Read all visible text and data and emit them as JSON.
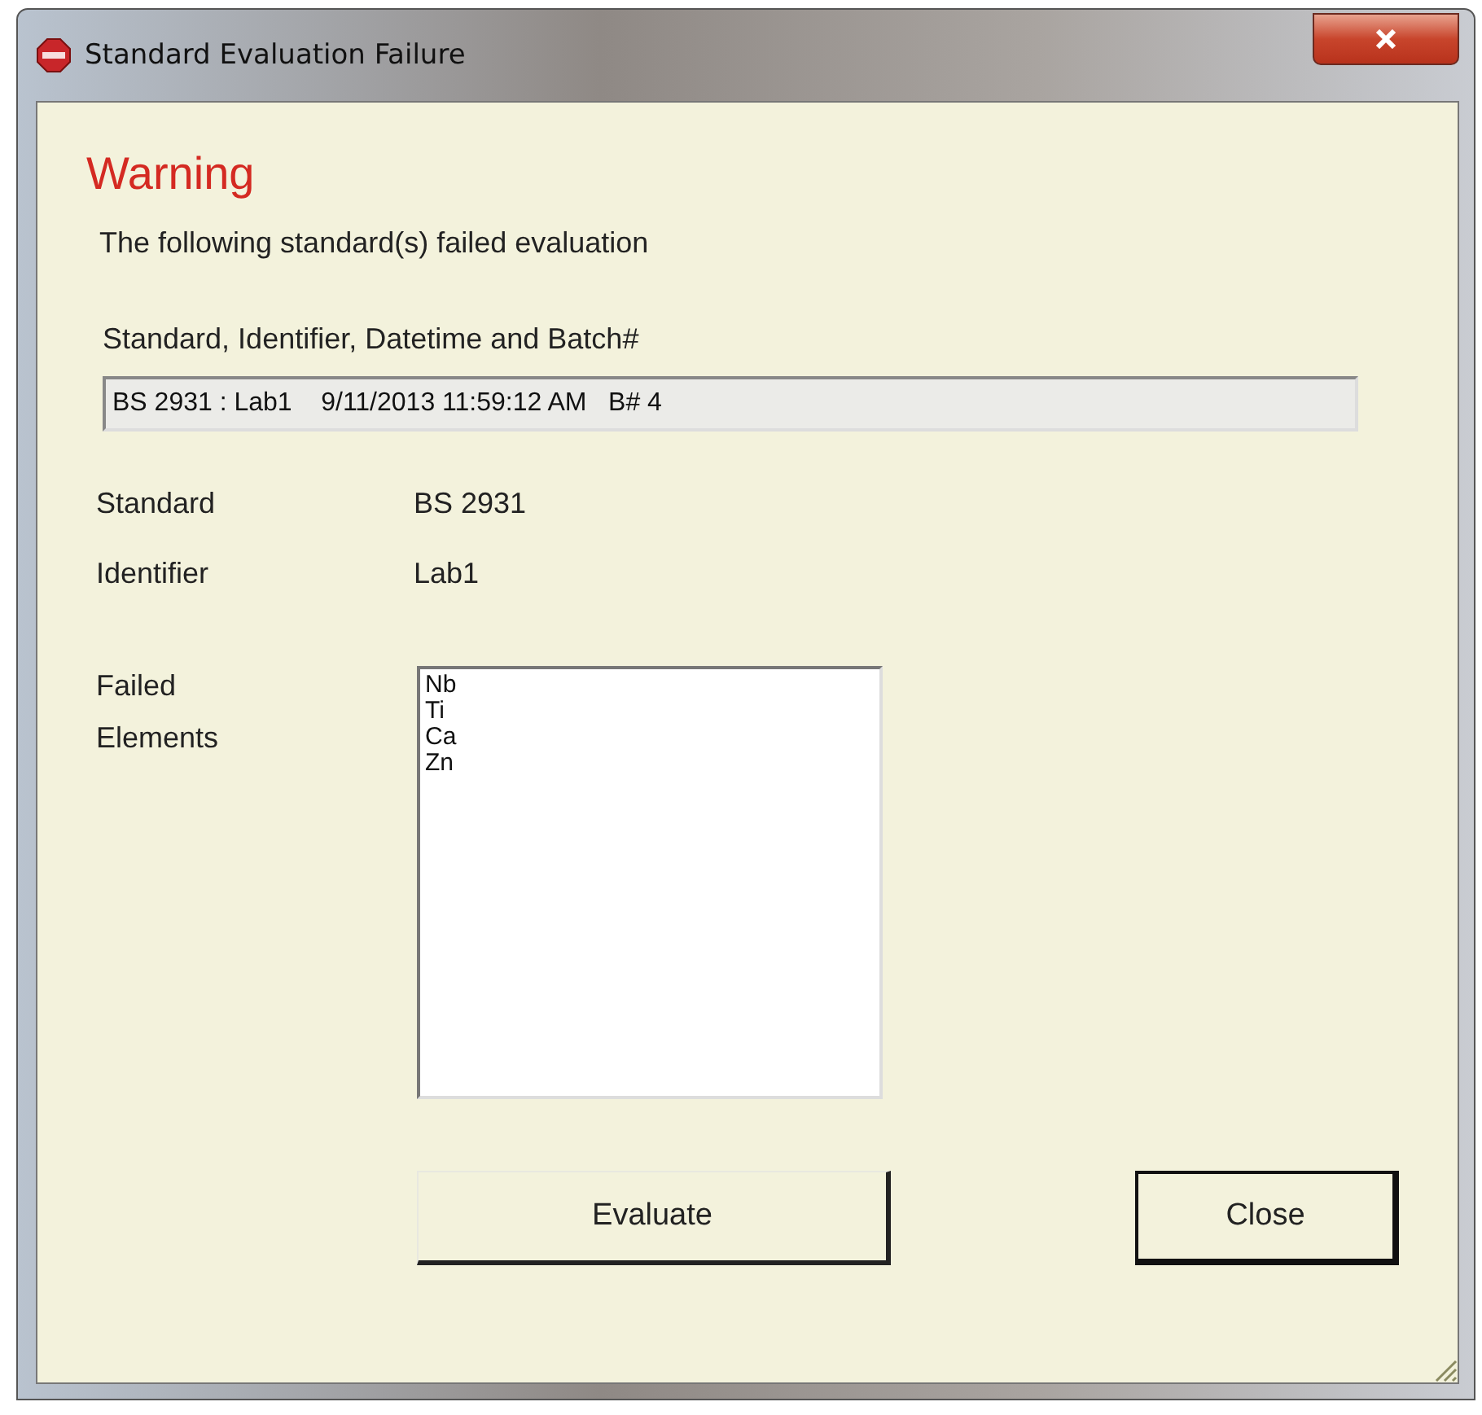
{
  "window": {
    "title": "Standard Evaluation Failure"
  },
  "heading": "Warning",
  "message": "The following standard(s) failed evaluation",
  "list_label": "Standard, Identifier, Datetime and Batch#",
  "entries": [
    {
      "text": "BS 2931 : Lab1    9/11/2013 11:59:12 AM   B# 4"
    }
  ],
  "details": [
    {
      "label": "Standard",
      "value": "BS 2931"
    },
    {
      "label": "Identifier",
      "value": "Lab1"
    }
  ],
  "failed": {
    "label": "Failed\nElements",
    "items": [
      "Nb",
      "Ti",
      "Ca",
      "Zn"
    ]
  },
  "buttons": [
    {
      "label": "Evaluate",
      "kind": "flat"
    },
    {
      "label": "Close",
      "kind": "default"
    }
  ]
}
